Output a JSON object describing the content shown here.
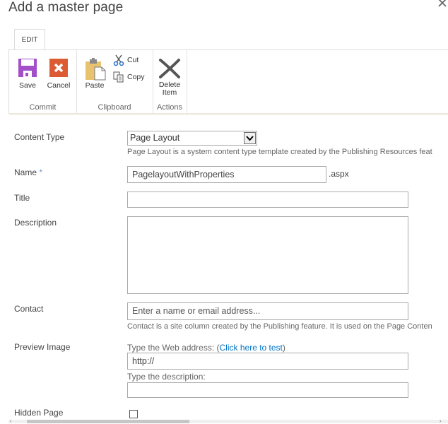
{
  "dialog": {
    "title": "Add a master page",
    "close_icon": "close-icon"
  },
  "ribbon": {
    "tabs": [
      {
        "label": "EDIT",
        "active": true
      }
    ],
    "groups": [
      {
        "label": "Commit",
        "buttons": [
          {
            "label": "Save",
            "icon": "save-icon",
            "color": "#a24fc9"
          },
          {
            "label": "Cancel",
            "icon": "cancel-icon",
            "color": "#dc5b32"
          }
        ]
      },
      {
        "label": "Clipboard",
        "buttons": [
          {
            "label": "Paste",
            "icon": "paste-icon",
            "color": "#e7c36f"
          },
          {
            "label": "Cut",
            "icon": "cut-icon"
          },
          {
            "label": "Copy",
            "icon": "copy-icon"
          }
        ]
      },
      {
        "label": "Actions",
        "buttons": [
          {
            "label_line1": "Delete",
            "label_line2": "Item",
            "icon": "delete-icon",
            "color": "#555555"
          }
        ]
      }
    ]
  },
  "form": {
    "content_type": {
      "label": "Content Type",
      "selected": "Page Layout",
      "hint": "Page Layout is a system content type template created by the Publishing Resources feat"
    },
    "name": {
      "label": "Name",
      "required_marker": "*",
      "value": "PagelayoutWithProperties",
      "suffix": ".aspx"
    },
    "title": {
      "label": "Title",
      "value": ""
    },
    "description": {
      "label": "Description",
      "value": ""
    },
    "contact": {
      "label": "Contact",
      "placeholder": "Enter a name or email address...",
      "hint": "Contact is a site column created by the Publishing feature. It is used on the Page Conten"
    },
    "preview_image": {
      "label": "Preview Image",
      "web_address_prefix": "Type the Web address: (",
      "test_link": "Click here to test",
      "web_address_suffix": ")",
      "url_value": "http://",
      "description_label": "Type the description:",
      "description_value": ""
    },
    "hidden_page": {
      "label": "Hidden Page",
      "checked": false
    }
  },
  "scrollbar": {
    "left_arrow": "‹",
    "right_arrow": "›"
  }
}
